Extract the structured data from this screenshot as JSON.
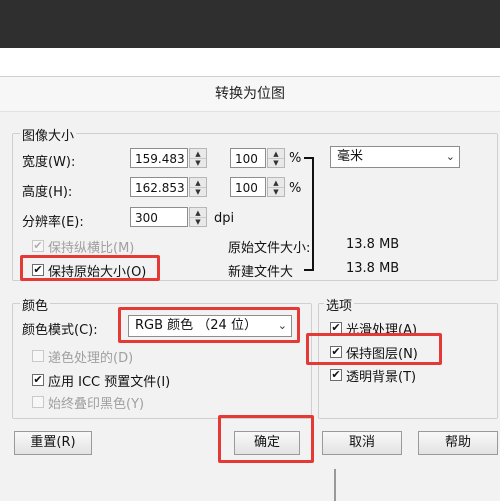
{
  "dialog": {
    "title": "转换为位图",
    "image_size": {
      "group_title": "图像大小",
      "width_label": "宽度(W):",
      "width_value": "159.483",
      "width_percent": "100",
      "height_label": "高度(H):",
      "height_value": "162.853",
      "height_percent": "100",
      "percent_sign": "%",
      "resolution_label": "分辨率(E):",
      "resolution_value": "300",
      "dpi_label": "dpi",
      "unit_value": "毫米",
      "keep_aspect_label": "保持纵横比(M)",
      "keep_original_size_label": "保持原始大小(O)",
      "original_file_size_label": "原始文件大小:",
      "original_file_size_value": "13.8 MB",
      "new_file_size_label": "新建文件大",
      "new_file_size_value": "13.8 MB"
    },
    "color": {
      "group_title": "颜色",
      "mode_label": "颜色模式(C):",
      "mode_value": "RGB 颜色 （24 位）",
      "dither_label": "递色处理的(D)",
      "icc_label": "应用 ICC 预置文件(I)",
      "overprint_label": "始终叠印黑色(Y)"
    },
    "options": {
      "group_title": "选项",
      "anti_alias_label": "光滑处理(A)",
      "keep_layers_label": "保持图层(N)",
      "transparent_bg_label": "透明背景(T)"
    },
    "buttons": {
      "reset": "重置(R)",
      "ok": "确定",
      "cancel": "取消",
      "help": "帮助"
    },
    "checkmark": "✔"
  },
  "colors": {
    "highlight": "#e53935",
    "dialog_bg": "#f2f2f2",
    "top_bar": "#2f2f2f"
  }
}
